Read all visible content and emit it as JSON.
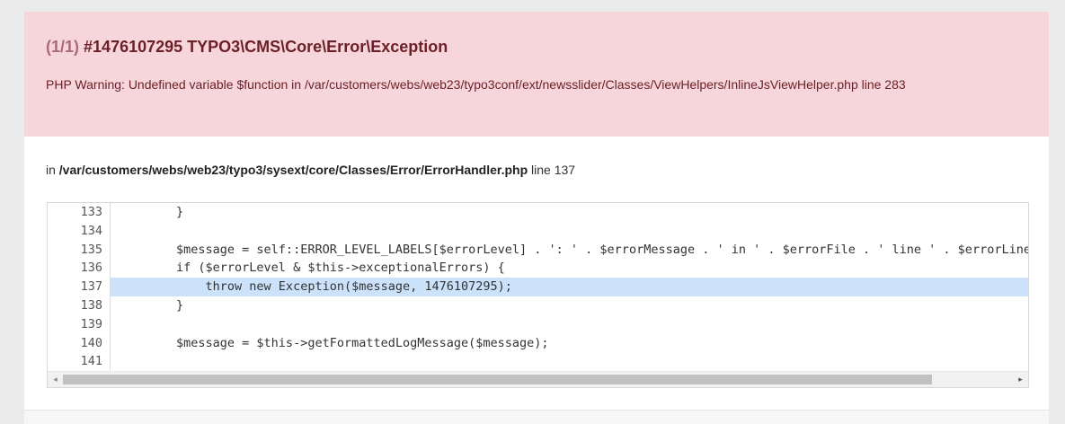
{
  "error": {
    "count": "(1/1)",
    "title": "#1476107295 TYPO3\\CMS\\Core\\Error\\Exception",
    "message": "PHP Warning: Undefined variable $function in /var/customers/webs/web23/typo3conf/ext/newsslider/Classes/ViewHelpers/InlineJsViewHelper.php line 283"
  },
  "location": {
    "prefix": "in",
    "file": "/var/customers/webs/web23/typo3/sysext/core/Classes/Error/ErrorHandler.php",
    "line_label": "line 137"
  },
  "code": {
    "lines": [
      {
        "num": "133",
        "text": "        }"
      },
      {
        "num": "134",
        "text": ""
      },
      {
        "num": "135",
        "text": "        $message = self::ERROR_LEVEL_LABELS[$errorLevel] . ': ' . $errorMessage . ' in ' . $errorFile . ' line ' . $errorLine;"
      },
      {
        "num": "136",
        "text": "        if ($errorLevel & $this->exceptionalErrors) {"
      },
      {
        "num": "137",
        "text": "            throw new Exception($message, 1476107295);"
      },
      {
        "num": "138",
        "text": "        }"
      },
      {
        "num": "139",
        "text": ""
      },
      {
        "num": "140",
        "text": "        $message = $this->getFormattedLogMessage($message);"
      },
      {
        "num": "141",
        "text": ""
      }
    ],
    "highlight_line": "137"
  },
  "scrollbar": {
    "left_arrow": "◂",
    "right_arrow": "▸"
  }
}
